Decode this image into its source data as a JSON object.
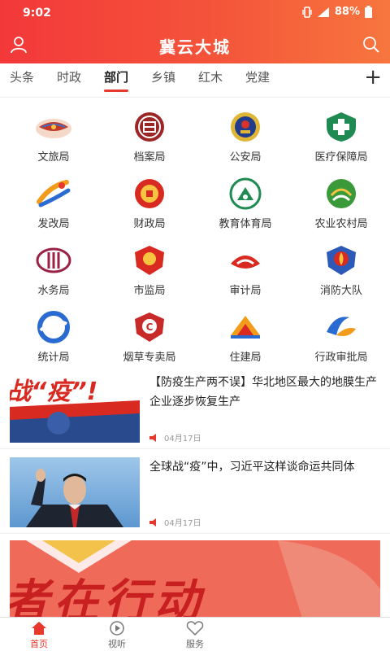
{
  "status": {
    "time": "9:02",
    "battery": "88%"
  },
  "app": {
    "title": "冀云大城"
  },
  "tabs": [
    {
      "label": "头条"
    },
    {
      "label": "时政"
    },
    {
      "label": "部门"
    },
    {
      "label": "乡镇"
    },
    {
      "label": "红木"
    },
    {
      "label": "党建"
    }
  ],
  "departments": [
    {
      "label": "文旅局",
      "icon": "culture-tourism-icon"
    },
    {
      "label": "档案局",
      "icon": "archives-icon"
    },
    {
      "label": "公安局",
      "icon": "police-badge-icon"
    },
    {
      "label": "医疗保障局",
      "icon": "medical-security-icon"
    },
    {
      "label": "发改局",
      "icon": "development-reform-icon"
    },
    {
      "label": "财政局",
      "icon": "finance-icon"
    },
    {
      "label": "教育体育局",
      "icon": "education-sports-icon"
    },
    {
      "label": "农业农村局",
      "icon": "agriculture-icon"
    },
    {
      "label": "水务局",
      "icon": "water-affairs-icon"
    },
    {
      "label": "市监局",
      "icon": "market-supervision-icon"
    },
    {
      "label": "审计局",
      "icon": "audit-icon"
    },
    {
      "label": "消防大队",
      "icon": "fire-brigade-icon"
    },
    {
      "label": "统计局",
      "icon": "statistics-icon"
    },
    {
      "label": "烟草专卖局",
      "icon": "tobacco-icon"
    },
    {
      "label": "住建局",
      "icon": "housing-construction-icon"
    },
    {
      "label": "行政审批局",
      "icon": "administrative-approval-icon"
    }
  ],
  "news": [
    {
      "title": "【防疫生产两不误】华北地区最大的地膜生产企业逐步恢复生产",
      "date": "04月17日",
      "thumb_text": "战“疫”!"
    },
    {
      "title": "全球战“疫”中，习近平这样谈命运共同体",
      "date": "04月17日"
    }
  ],
  "banner": {
    "text": "者在行动"
  },
  "bottom_nav": [
    {
      "label": "首页",
      "icon": "home-icon"
    },
    {
      "label": "视听",
      "icon": "play-icon"
    },
    {
      "label": "服务",
      "icon": "heart-icon"
    }
  ],
  "colors": {
    "brand": "#e8382c",
    "header_start": "#f3383a",
    "header_end": "#f7763e"
  }
}
